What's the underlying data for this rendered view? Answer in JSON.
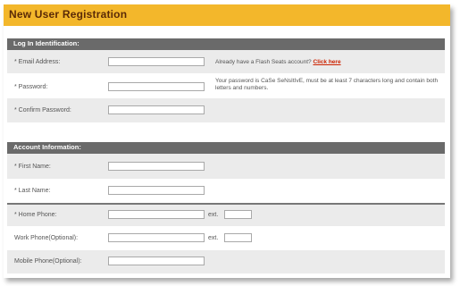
{
  "page": {
    "title": "New User Registration"
  },
  "login_section": {
    "header": "Log In Identification:",
    "email_label": "* Email Address:",
    "password_label": "* Password:",
    "confirm_label": "* Confirm Password:",
    "account_prompt": "Already have a Flash Seats account?",
    "click_here": "Click here",
    "password_hint": "Your password is CaSe SeNsItIvE, must be at least 7 characters long and contain both letters and numbers."
  },
  "account_section": {
    "header": "Account Information:",
    "first_name_label": "* First Name:",
    "last_name_label": "* Last Name:",
    "home_phone_label": "* Home Phone:",
    "work_phone_label": "Work Phone(Optional):",
    "mobile_phone_label": "Mobile Phone(Optional):",
    "ext_label": "ext."
  },
  "colors": {
    "title_bar": "#f3b72b",
    "section_header": "#6a6a6a",
    "link": "#cc2200"
  }
}
